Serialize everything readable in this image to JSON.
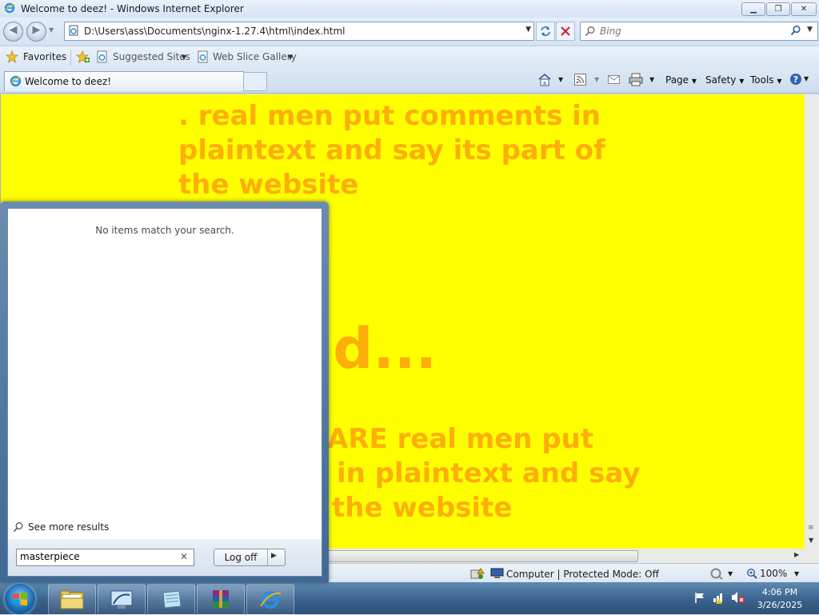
{
  "window": {
    "title": "Welcome to deez! - Windows Internet Explorer"
  },
  "address_bar": {
    "url": "D:\\Users\\ass\\Documents\\nginx-1.27.4\\html\\index.html"
  },
  "search_box": {
    "placeholder": "Bing"
  },
  "favorites_bar": {
    "favorites_label": "Favorites",
    "items": [
      "Suggested Sites",
      "Web Slice Gallery"
    ]
  },
  "tabs": [
    {
      "label": "Welcome to deez!"
    }
  ],
  "command_bar": {
    "page": "Page",
    "safety": "Safety",
    "tools": "Tools"
  },
  "page_content": {
    "line1": ". real men put comments in",
    "line2": "plaintext and say its part of",
    "line3": "the website",
    "big": "ad...",
    "line4": "WARE real men put",
    "line5": "in plaintext and say",
    "line6": "the website"
  },
  "status_bar": {
    "zone": "Computer | Protected Mode: Off",
    "zoom": "100%"
  },
  "start_menu": {
    "no_results": "No items match your search.",
    "see_more": "See more results",
    "search_value": "masterpiece",
    "logoff": "Log off"
  },
  "taskbar": {
    "time": "4:06 PM",
    "date": "3/26/2025",
    "pinned": [
      "windows-explorer",
      "remote-desktop",
      "notepad",
      "winrar",
      "internet-explorer"
    ]
  },
  "colors": {
    "page_background": "#ffff00",
    "page_text": "#fdae0b",
    "taskbar": "#3a628c"
  }
}
